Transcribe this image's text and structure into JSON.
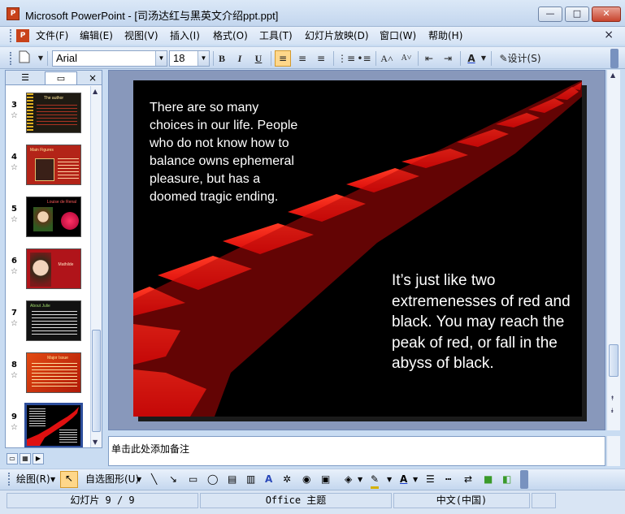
{
  "window": {
    "title": "Microsoft PowerPoint - [司汤达红与黑英文介绍ppt.ppt]",
    "minimize": "—",
    "maximize": "□",
    "close": "✕"
  },
  "menu": {
    "items": [
      "文件(F)",
      "编辑(E)",
      "视图(V)",
      "插入(I)",
      "格式(O)",
      "工具(T)",
      "幻灯片放映(D)",
      "窗口(W)",
      "帮助(H)"
    ],
    "close": "×"
  },
  "toolbar": {
    "font_name": "Arial",
    "font_size": "18",
    "bold": "B",
    "italic": "I",
    "underline": "U",
    "design_label": "设计(S)"
  },
  "panel": {
    "close": "×",
    "slides": [
      {
        "num": "3",
        "title": "The author",
        "bg": "#1e1a12"
      },
      {
        "num": "4",
        "title": "Main Figures",
        "bg": "#b32418"
      },
      {
        "num": "5",
        "title": "Louise de Renal",
        "bg": "#000000"
      },
      {
        "num": "6",
        "title": "Mathilde",
        "bg": "#b0141a"
      },
      {
        "num": "7",
        "title": "About Julie",
        "bg": "#111111"
      },
      {
        "num": "8",
        "title": "Major Issue",
        "bg": "#d43b0a"
      },
      {
        "num": "9",
        "title": "",
        "bg": "#000000"
      }
    ]
  },
  "slide": {
    "text_left": "There are so many choices in our life. People who do not know how to balance owns ephemeral pleasure, but has a doomed tragic ending.",
    "text_right": "It’s just like two extremenesses of red and black. You may reach the peak of red, or fall in the abyss of black."
  },
  "notes": {
    "placeholder": "单击此处添加备注"
  },
  "drawbar": {
    "draw_label": "绘图(R)",
    "autoshapes_label": "自选图形(U)"
  },
  "status": {
    "slide_info": "幻灯片 9 / 9",
    "theme": "Office 主题",
    "language": "中文(中国)"
  }
}
